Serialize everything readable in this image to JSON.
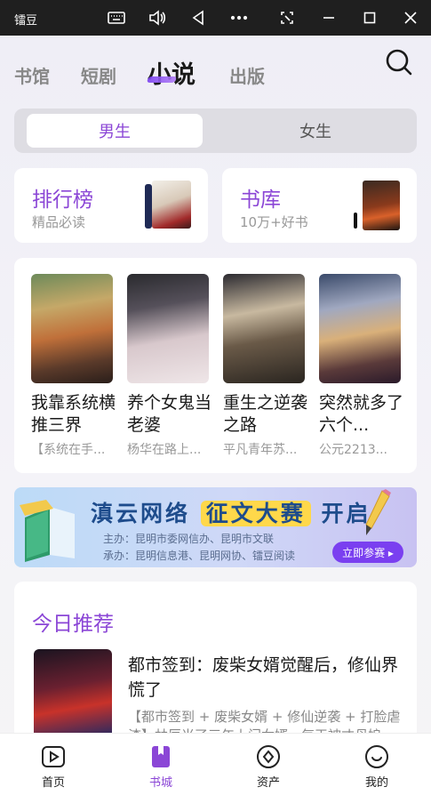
{
  "window": {
    "app_name": "镭豆"
  },
  "header": {
    "tabs": [
      {
        "label": "书馆"
      },
      {
        "label": "短剧"
      },
      {
        "label": "小说"
      },
      {
        "label": "出版"
      }
    ],
    "active_tab": "小说"
  },
  "gender": {
    "male": "男生",
    "female": "女生",
    "selected": "男生"
  },
  "quick_cards": [
    {
      "title": "排行榜",
      "subtitle": "精品必读"
    },
    {
      "title": "书库",
      "subtitle": "10万+好书"
    }
  ],
  "books": [
    {
      "title": "我靠系统横推三界",
      "meta": "【系统在手..."
    },
    {
      "title": "养个女鬼当老婆",
      "meta": "杨华在路上..."
    },
    {
      "title": "重生之逆袭之路",
      "meta": "平凡青年苏..."
    },
    {
      "title": "突然就多了六个...",
      "meta": "公元2213..."
    }
  ],
  "banner": {
    "title_prefix": "滇云网络",
    "title_highlight": "征文大赛",
    "title_suffix": "开启",
    "host": "主办：昆明市委网信办、昆明市文联",
    "organizer": "承办：昆明信息港、昆明网协、镭豆阅读",
    "cta": "立即参赛 ▸"
  },
  "recommend": {
    "heading": "今日推荐",
    "title": "都市签到：废柴女婿觉醒后，修仙界慌了",
    "desc": "【都市签到 + 废柴女婿 + 修仙逆袭 + 打脸虐渣】林辰当了三年上门女婿，每天被丈母娘"
  },
  "bottom_nav": [
    {
      "label": "首页",
      "icon": "play-icon"
    },
    {
      "label": "书城",
      "icon": "bookmark-icon"
    },
    {
      "label": "资产",
      "icon": "diamond-icon"
    },
    {
      "label": "我的",
      "icon": "smile-icon"
    }
  ],
  "colors": {
    "accent": "#8b46d6",
    "titlebar": "#1f1f1f"
  }
}
